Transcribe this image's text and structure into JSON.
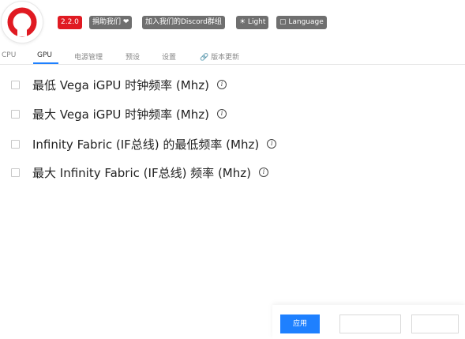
{
  "header": {
    "version": "2.2.0",
    "donate": "捐助我们 ❤",
    "discord": "加入我们的Discord群组",
    "theme": "☀ Light",
    "language": "▢ Language"
  },
  "tabs": [
    {
      "label": "CPU"
    },
    {
      "label": "GPU"
    },
    {
      "label": "电源管理"
    },
    {
      "label": "预设"
    },
    {
      "label": "设置"
    },
    {
      "label": "🔗 版本更新"
    }
  ],
  "settings": [
    {
      "label": "最低 Vega iGPU 时钟频率 (Mhz)",
      "checked": false
    },
    {
      "label": "最大 Vega iGPU 时钟频率 (Mhz)",
      "checked": false
    },
    {
      "label": " Infinity Fabric (IF总线) 的最低频率 (Mhz)",
      "checked": false
    },
    {
      "label": "最大 Infinity Fabric (IF总线) 频率 (Mhz)",
      "checked": false
    }
  ],
  "footer": {
    "apply": "应用",
    "button2": "",
    "button3": ""
  },
  "colors": {
    "brand": "#e01a22",
    "accent": "#1e80ff",
    "badge_gray": "#6f6f6f"
  },
  "icons": {
    "logo": "ryzen-logo-icon",
    "info": "info-icon"
  }
}
